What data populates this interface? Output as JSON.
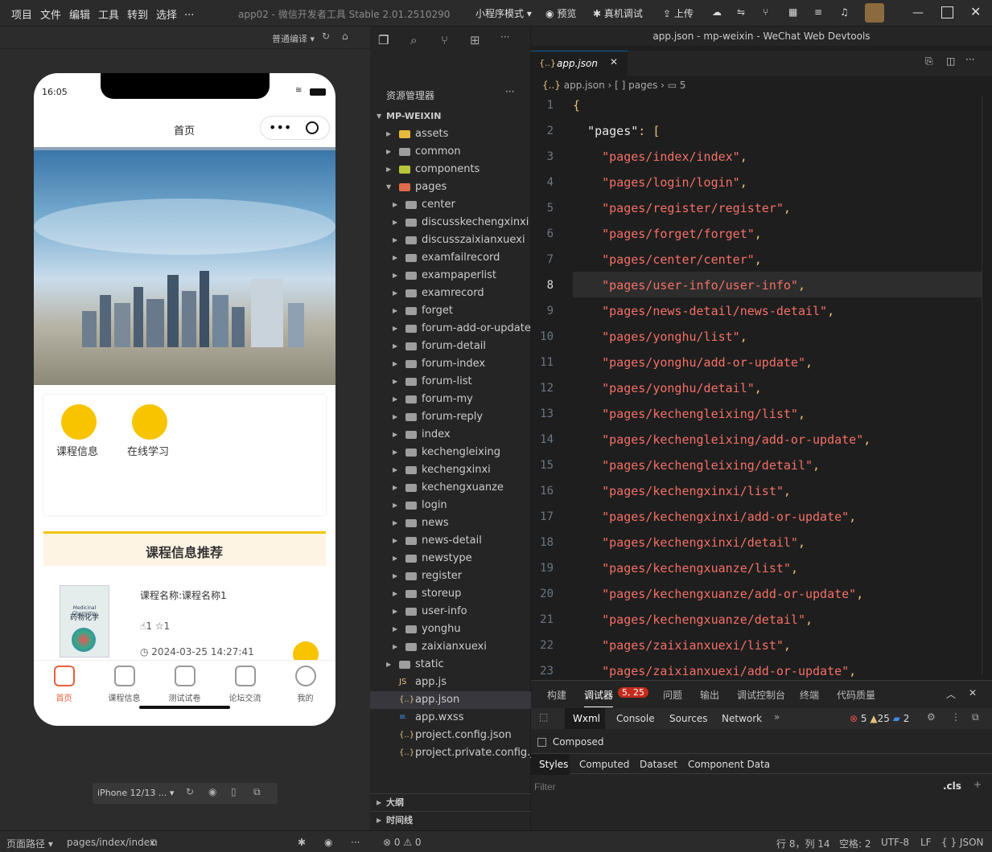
{
  "menubar": {
    "items": [
      "项目",
      "文件",
      "编辑",
      "工具",
      "转到",
      "选择",
      "..."
    ],
    "title": "app02 - 微信开发者工具 Stable 2.01.2510290",
    "mode": "小程序模式",
    "preview": "预览",
    "remote_debug": "真机调试",
    "upload": "上传"
  },
  "window_title": "app.json - mp-weixin - WeChat Web Devtools",
  "simulator": {
    "compile_mode": "普通编译",
    "device": "iPhone 12/13 ...",
    "time": "16:05",
    "page_title": "首页",
    "categories": [
      {
        "label": "课程信息"
      },
      {
        "label": "在线学习"
      }
    ],
    "recommend_title": "课程信息推荐",
    "course": {
      "name": "课程名称:课程名称1",
      "likes": "1",
      "stars": "1",
      "date": "2024-03-25 14:27:41",
      "book_en": "Medicinal Chemistry",
      "book_cn": "药物化学"
    },
    "tabbar": [
      {
        "label": "首页"
      },
      {
        "label": "课程信息"
      },
      {
        "label": "测试试卷"
      },
      {
        "label": "论坛交流"
      },
      {
        "label": "我的"
      }
    ]
  },
  "explorer": {
    "title": "资源管理器",
    "root": "MP-WEIXIN",
    "items": [
      {
        "label": "assets",
        "depth": 1,
        "type": "folder"
      },
      {
        "label": "common",
        "depth": 1,
        "type": "folder"
      },
      {
        "label": "components",
        "depth": 1,
        "type": "folder"
      },
      {
        "label": "pages",
        "depth": 1,
        "type": "folder-open"
      },
      {
        "label": "center",
        "depth": 2,
        "type": "folder"
      },
      {
        "label": "discusskechengxinxi",
        "depth": 2,
        "type": "folder"
      },
      {
        "label": "discusszaixianxuexi",
        "depth": 2,
        "type": "folder"
      },
      {
        "label": "examfailrecord",
        "depth": 2,
        "type": "folder"
      },
      {
        "label": "exampaperlist",
        "depth": 2,
        "type": "folder"
      },
      {
        "label": "examrecord",
        "depth": 2,
        "type": "folder"
      },
      {
        "label": "forget",
        "depth": 2,
        "type": "folder"
      },
      {
        "label": "forum-add-or-update",
        "depth": 2,
        "type": "folder"
      },
      {
        "label": "forum-detail",
        "depth": 2,
        "type": "folder"
      },
      {
        "label": "forum-index",
        "depth": 2,
        "type": "folder"
      },
      {
        "label": "forum-list",
        "depth": 2,
        "type": "folder"
      },
      {
        "label": "forum-my",
        "depth": 2,
        "type": "folder"
      },
      {
        "label": "forum-reply",
        "depth": 2,
        "type": "folder"
      },
      {
        "label": "index",
        "depth": 2,
        "type": "folder"
      },
      {
        "label": "kechengleixing",
        "depth": 2,
        "type": "folder"
      },
      {
        "label": "kechengxinxi",
        "depth": 2,
        "type": "folder"
      },
      {
        "label": "kechengxuanze",
        "depth": 2,
        "type": "folder"
      },
      {
        "label": "login",
        "depth": 2,
        "type": "folder"
      },
      {
        "label": "news",
        "depth": 2,
        "type": "folder"
      },
      {
        "label": "news-detail",
        "depth": 2,
        "type": "folder"
      },
      {
        "label": "newstype",
        "depth": 2,
        "type": "folder"
      },
      {
        "label": "register",
        "depth": 2,
        "type": "folder"
      },
      {
        "label": "storeup",
        "depth": 2,
        "type": "folder"
      },
      {
        "label": "user-info",
        "depth": 2,
        "type": "folder"
      },
      {
        "label": "yonghu",
        "depth": 2,
        "type": "folder"
      },
      {
        "label": "zaixianxuexi",
        "depth": 2,
        "type": "folder"
      },
      {
        "label": "static",
        "depth": 1,
        "type": "folder"
      },
      {
        "label": "app.js",
        "depth": 1,
        "type": "js"
      },
      {
        "label": "app.json",
        "depth": 1,
        "type": "json"
      },
      {
        "label": "app.wxss",
        "depth": 1,
        "type": "css"
      },
      {
        "label": "project.config.json",
        "depth": 1,
        "type": "json"
      },
      {
        "label": "project.private.config.js...",
        "depth": 1,
        "type": "json"
      }
    ],
    "outline": "大纲",
    "timeline": "时间线"
  },
  "editor": {
    "tab": "app.json",
    "breadcrumb": [
      "app.json",
      "[ ] pages",
      "5"
    ],
    "lines": [
      {
        "n": "1",
        "t": "{"
      },
      {
        "n": "2",
        "t": "  \"pages\": ["
      },
      {
        "n": "3",
        "t": "    \"pages/index/index\","
      },
      {
        "n": "4",
        "t": "    \"pages/login/login\","
      },
      {
        "n": "5",
        "t": "    \"pages/register/register\","
      },
      {
        "n": "6",
        "t": "    \"pages/forget/forget\","
      },
      {
        "n": "7",
        "t": "    \"pages/center/center\","
      },
      {
        "n": "8",
        "t": "    \"pages/user-info/user-info\","
      },
      {
        "n": "9",
        "t": "    \"pages/news-detail/news-detail\","
      },
      {
        "n": "10",
        "t": "    \"pages/yonghu/list\","
      },
      {
        "n": "11",
        "t": "    \"pages/yonghu/add-or-update\","
      },
      {
        "n": "12",
        "t": "    \"pages/yonghu/detail\","
      },
      {
        "n": "13",
        "t": "    \"pages/kechengleixing/list\","
      },
      {
        "n": "14",
        "t": "    \"pages/kechengleixing/add-or-update\","
      },
      {
        "n": "15",
        "t": "    \"pages/kechengleixing/detail\","
      },
      {
        "n": "16",
        "t": "    \"pages/kechengxinxi/list\","
      },
      {
        "n": "17",
        "t": "    \"pages/kechengxinxi/add-or-update\","
      },
      {
        "n": "18",
        "t": "    \"pages/kechengxinxi/detail\","
      },
      {
        "n": "19",
        "t": "    \"pages/kechengxuanze/list\","
      },
      {
        "n": "20",
        "t": "    \"pages/kechengxuanze/add-or-update\","
      },
      {
        "n": "21",
        "t": "    \"pages/kechengxuanze/detail\","
      },
      {
        "n": "22",
        "t": "    \"pages/zaixianxuexi/list\","
      },
      {
        "n": "23",
        "t": "    \"pages/zaixianxuexi/add-or-update\","
      }
    ]
  },
  "devtools": {
    "tabs": [
      "构建",
      "调试器",
      "问题",
      "输出",
      "调试控制台",
      "终端",
      "代码质量"
    ],
    "debugger_badge": "5, 25",
    "subtabs": [
      "Wxml",
      "Console",
      "Sources",
      "Network"
    ],
    "errors": "5",
    "warnings": "25",
    "infos": "2",
    "composed": "Composed",
    "style_tabs": [
      "Styles",
      "Computed",
      "Dataset",
      "Component Data"
    ],
    "filter_placeholder": "Filter",
    "cls": ".cls"
  },
  "statusbar": {
    "page_path_label": "页面路径",
    "page_path": "pages/index/index",
    "problems_errors": "0",
    "problems_warnings": "0",
    "cursor": "行 8，列 14",
    "spaces": "空格: 2",
    "encoding": "UTF-8",
    "eol": "LF",
    "language": "JSON"
  }
}
